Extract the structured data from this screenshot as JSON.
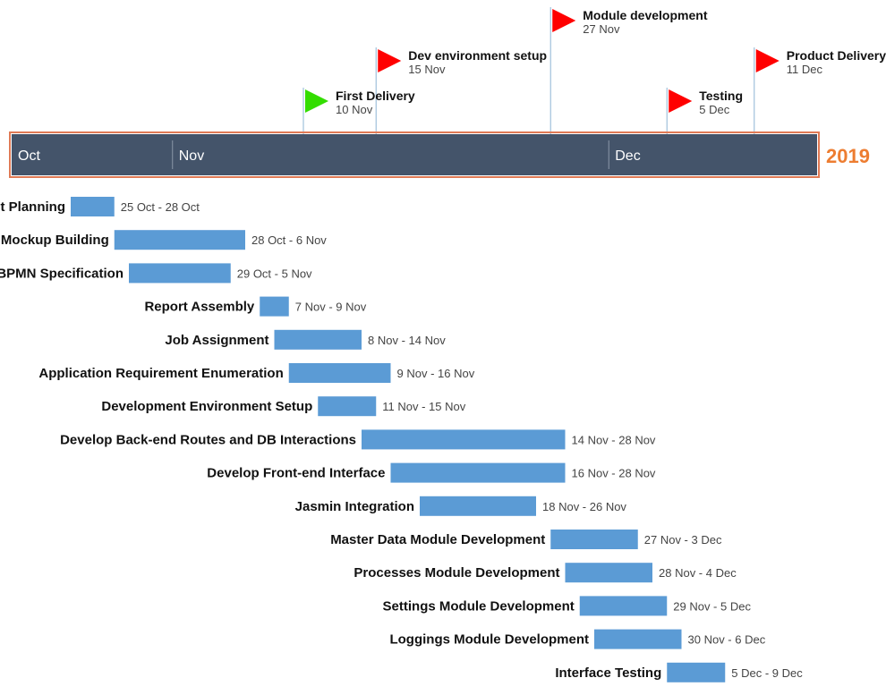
{
  "chart_data": {
    "type": "gantt",
    "year": "2019",
    "colors": {
      "band": "#44546a",
      "band_border": "#e07a55",
      "bar": "#5b9bd5",
      "year": "#ed7d31",
      "milestone_red": "#ff0000",
      "milestone_green": "#33dd00",
      "milestone_line": "#9fc0dc"
    },
    "months": [
      {
        "label": "Oct",
        "start": "2019-10-21"
      },
      {
        "label": "Nov",
        "start": "2019-11-01"
      },
      {
        "label": "Dec",
        "start": "2019-12-01"
      }
    ],
    "axis_range": [
      "2019-10-21",
      "2019-12-16"
    ],
    "milestones": [
      {
        "label": "Module development",
        "date_text": "27 Nov",
        "date": "2019-11-27",
        "tier": 0,
        "color": "red"
      },
      {
        "label": "Dev environment setup",
        "date_text": "15 Nov",
        "date": "2019-11-15",
        "tier": 1,
        "color": "red"
      },
      {
        "label": "Product Delivery",
        "date_text": "11 Dec",
        "date": "2019-12-11",
        "tier": 1,
        "color": "red"
      },
      {
        "label": "First Delivery",
        "date_text": "10 Nov",
        "date": "2019-11-10",
        "tier": 2,
        "color": "green"
      },
      {
        "label": "Testing",
        "date_text": "5 Dec",
        "date": "2019-12-05",
        "tier": 2,
        "color": "red"
      }
    ],
    "tasks": [
      {
        "name": "Project Planning",
        "start": "2019-10-25",
        "end": "2019-10-28",
        "range_text": "25 Oct - 28 Oct"
      },
      {
        "name": "Mockup Building",
        "start": "2019-10-28",
        "end": "2019-11-06",
        "range_text": "28 Oct - 6 Nov"
      },
      {
        "name": "BPMN Specification",
        "start": "2019-10-29",
        "end": "2019-11-05",
        "range_text": "29 Oct - 5 Nov"
      },
      {
        "name": "Report Assembly",
        "start": "2019-11-07",
        "end": "2019-11-09",
        "range_text": "7 Nov - 9 Nov"
      },
      {
        "name": "Job Assignment",
        "start": "2019-11-08",
        "end": "2019-11-14",
        "range_text": "8 Nov - 14 Nov"
      },
      {
        "name": "Application Requirement Enumeration",
        "start": "2019-11-09",
        "end": "2019-11-16",
        "range_text": "9 Nov - 16 Nov"
      },
      {
        "name": "Development Environment Setup",
        "start": "2019-11-11",
        "end": "2019-11-15",
        "range_text": "11 Nov - 15 Nov"
      },
      {
        "name": "Develop Back-end Routes and DB Interactions",
        "start": "2019-11-14",
        "end": "2019-11-28",
        "range_text": "14 Nov - 28 Nov"
      },
      {
        "name": "Develop Front-end Interface",
        "start": "2019-11-16",
        "end": "2019-11-28",
        "range_text": "16 Nov - 28 Nov"
      },
      {
        "name": "Jasmin Integration",
        "start": "2019-11-18",
        "end": "2019-11-26",
        "range_text": "18 Nov - 26 Nov"
      },
      {
        "name": "Master Data Module Development",
        "start": "2019-11-27",
        "end": "2019-12-03",
        "range_text": "27 Nov - 3 Dec"
      },
      {
        "name": "Processes Module Development",
        "start": "2019-11-28",
        "end": "2019-12-04",
        "range_text": "28 Nov - 4 Dec"
      },
      {
        "name": "Settings Module Development",
        "start": "2019-11-29",
        "end": "2019-12-05",
        "range_text": "29 Nov - 5 Dec"
      },
      {
        "name": "Loggings Module Development",
        "start": "2019-11-30",
        "end": "2019-12-06",
        "range_text": "30 Nov - 6 Dec"
      },
      {
        "name": "Interface Testing",
        "start": "2019-12-05",
        "end": "2019-12-09",
        "range_text": "5 Dec - 9 Dec"
      }
    ]
  }
}
